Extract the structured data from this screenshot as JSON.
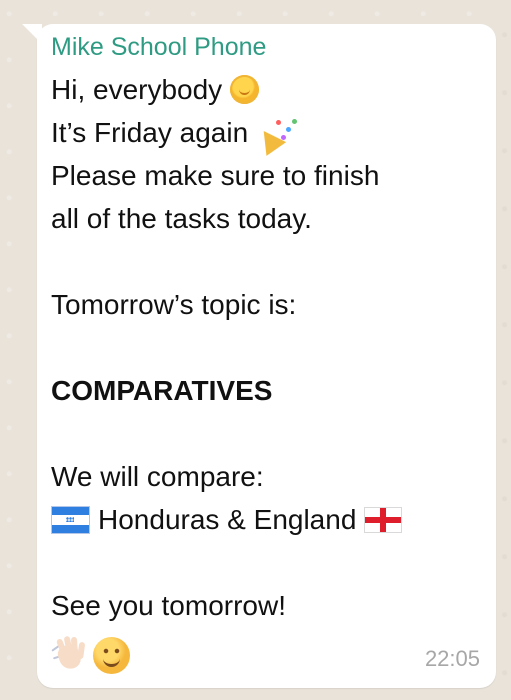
{
  "chat": {
    "sender": "Mike School Phone",
    "timestamp": "22:05",
    "message_lines": [
      "Hi, everybody",
      "It’s Friday again",
      "Please make sure to finish",
      "all of the tasks today.",
      "",
      "Tomorrow’s topic is:",
      "",
      "COMPARATIVES",
      "",
      "We will compare:",
      "Honduras & England",
      "",
      "See you tomorrow!"
    ]
  },
  "icons": {
    "line_1": "sun-icon",
    "line_2": "party-popper-icon",
    "line_11_start": "honduras-flag-icon",
    "line_11_end": "england-flag-icon",
    "footer_1": "waving-hand-icon",
    "footer_2": "smiling-face-icon"
  },
  "colors": {
    "sender": "#2f9b83",
    "bubble": "#ffffff",
    "background": "#e9e3da",
    "timestamp": "#a7a7a7"
  }
}
